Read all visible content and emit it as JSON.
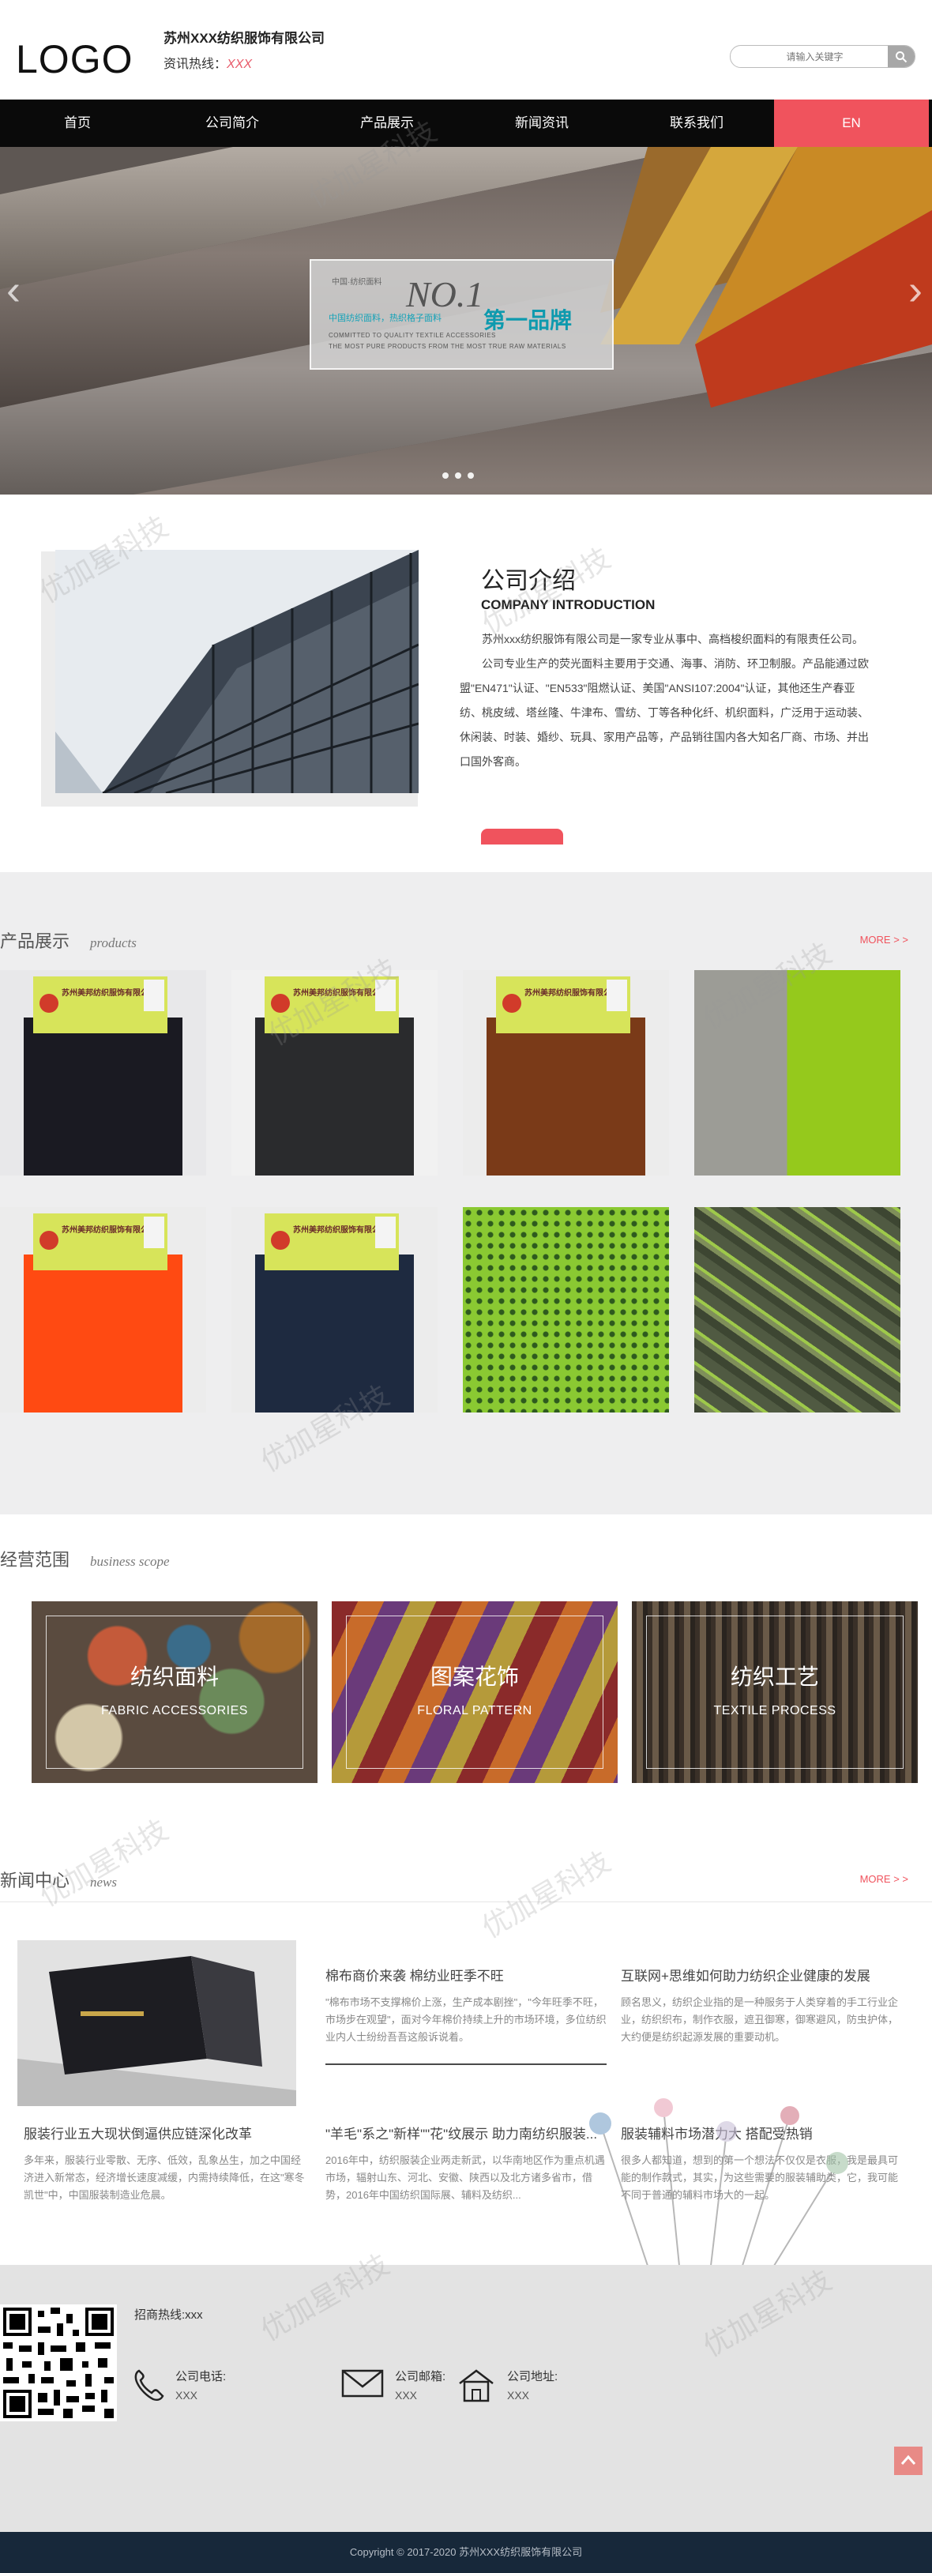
{
  "header": {
    "logo": "LOGO",
    "company_name": "苏州XXX纺织服饰有限公司",
    "hotline_label": "资讯热线：",
    "hotline_value": "XXX",
    "search_placeholder": "请输入关键字",
    "search_icon": "search-icon"
  },
  "nav": {
    "items": [
      "首页",
      "公司简介",
      "产品展示",
      "新闻资讯",
      "联系我们",
      "EN"
    ],
    "active_color": "#f0535d"
  },
  "banner": {
    "badge_top": "中国·纺织面料",
    "no1": "NO.1",
    "line1": "中国纺织面料，热织格子面料",
    "first_brand": "第一品牌",
    "line2": "COMMITTED TO QUALITY TEXTILE ACCESSORIES",
    "line3": "THE MOST PURE PRODUCTS FROM THE MOST TRUE RAW MATERIALS",
    "prev_arrow": "‹",
    "next_arrow": "›"
  },
  "intro": {
    "title": "公司介绍",
    "subtitle": "COMPANY INTRODUCTION",
    "paragraph1": "苏州xxx纺织服饰有限公司是一家专业从事中、高档梭织面料的有限责任公司。",
    "paragraph2": "公司专业生产的荧光面料主要用于交通、海事、消防、环卫制服。产品能通过欧盟\"EN471\"认证、\"EN533\"阻燃认证、美国\"ANSI107:2004\"认证，其他还生产春亚纺、桃皮绒、塔丝隆、牛津布、雪纺、丁等各种化纤、机织面料，广泛用于运动装、休闲装、时装、婚纱、玩具、家用产品等，产品销往国内各大知名厂商、市场、并出口国外客商。"
  },
  "products": {
    "title_cn": "产品展示",
    "title_en": "products",
    "more": "MORE > >",
    "label_text": "苏州美邦纺织服饰有限公司",
    "items": [
      {
        "name": "product-black-fabric",
        "color": "#1a1a22",
        "bg": "#e8e8ea",
        "label": true
      },
      {
        "name": "product-dark-grey-fabric",
        "color": "#2a2b2d",
        "bg": "#f1f1f1",
        "label": true
      },
      {
        "name": "product-brown-fabric",
        "color": "#7a3a18",
        "bg": "#ececec",
        "label": true
      },
      {
        "name": "product-lime-grey-fabric",
        "color": "#95c91c",
        "bg": "#9c9c96",
        "label": false
      },
      {
        "name": "product-orange-fabric",
        "color": "#ff4a12",
        "bg": "#ececec",
        "label": true
      },
      {
        "name": "product-navy-fabric",
        "color": "#1e2a40",
        "bg": "#ececec",
        "label": true
      },
      {
        "name": "product-green-pattern-fabric",
        "color": "#8ac932",
        "bg": "#8ac932",
        "label": false
      },
      {
        "name": "product-camo-fabric",
        "color": "#566048",
        "bg": "#566048",
        "label": false
      }
    ]
  },
  "scope": {
    "title_cn": "经营范围",
    "title_en": "business scope",
    "tiles": [
      {
        "cn": "纺织面料",
        "en": "FABRIC ACCESSORIES"
      },
      {
        "cn": "图案花饰",
        "en": "FLORAL PATTERN"
      },
      {
        "cn": "纺织工艺",
        "en": "TEXTILE PROCESS"
      }
    ]
  },
  "news": {
    "title_cn": "新闻中心",
    "title_en": "news",
    "more": "MORE > >",
    "items": [
      {
        "title": "棉布商价来袭 棉纺业旺季不旺",
        "text": "\"棉布市场不支撑棉价上涨，生产成本剧挫\"，\"今年旺季不旺，市场步在观望\"，面对今年棉价持续上升的市场环境，多位纺织业内人士纷纷吾吾这般诉说着。"
      },
      {
        "title": "互联网+思维如何助力纺织企业健康的发展",
        "text": "顾名思义，纺织企业指的是一种服务于人类穿着的手工行业企业，纺织织布，制作衣服，遮丑御寒，御寒避风，防虫护体，大约便是纺织起源发展的重要动机。"
      },
      {
        "title": "服装行业五大现状倒逼供应链深化改革",
        "text": "多年来，服装行业零散、无序、低效，乱象丛生，加之中国经济进入新常态，经济增长速度减缓，内需持续降低，在这\"寒冬凯世\"中，中国服装制造业危晨。"
      },
      {
        "title": "\"羊毛\"系之\"新样\"\"花\"纹展示 助力南纺织服装...",
        "text": "2016年中，纺织服装企业两走新武，以华南地区作为重点机遇市场，辐射山东、河北、安徽、陕西以及北方诸多省市，借势，2016年中国纺织国际展、辅料及纺织..."
      },
      {
        "title": "服装辅料市场潜力大 搭配受热销",
        "text": "很多人都知道，想到的第一个想法不仅仅是衣服，我是最具可能的制作款式，其实，为这些需要的服装辅助类，它，我可能不同于普通的辅料市场大的一起。"
      }
    ]
  },
  "footer": {
    "hotline": "招商热线:xxx",
    "phone_label": "公司电话:",
    "phone_value": "XXX",
    "email_label": "公司邮箱:",
    "email_value": "XXX",
    "address_label": "公司地址:",
    "address_value": "XXX",
    "copyright": "Copyright © 2017-2020 苏州XXX纺织服饰有限公司"
  },
  "watermark_text": "优加星科技"
}
